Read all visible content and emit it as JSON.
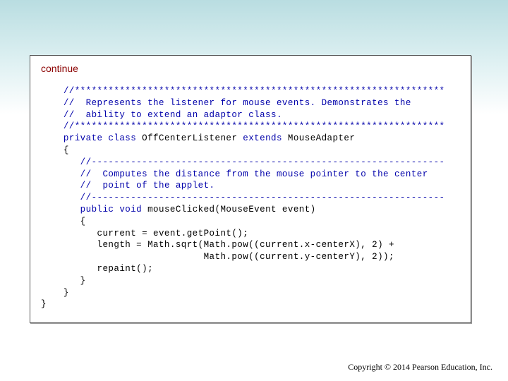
{
  "slide": {
    "heading": "continue",
    "copyright": "Copyright © 2014 Pearson Education, Inc."
  },
  "code_lines": [
    {
      "indent": "    ",
      "segments": [
        {
          "t": "//******************************************************************",
          "c": "cm"
        }
      ]
    },
    {
      "indent": "    ",
      "segments": [
        {
          "t": "//  Represents the listener for mouse events. Demonstrates the",
          "c": "cm"
        }
      ]
    },
    {
      "indent": "    ",
      "segments": [
        {
          "t": "//  ability to extend an adaptor class.",
          "c": "cm"
        }
      ]
    },
    {
      "indent": "    ",
      "segments": [
        {
          "t": "//******************************************************************",
          "c": "cm"
        }
      ]
    },
    {
      "indent": "    ",
      "segments": [
        {
          "t": "private class ",
          "c": "kw"
        },
        {
          "t": "OffCenterListener ",
          "c": ""
        },
        {
          "t": "extends ",
          "c": "kw"
        },
        {
          "t": "MouseAdapter",
          "c": ""
        }
      ]
    },
    {
      "indent": "    ",
      "segments": [
        {
          "t": "{",
          "c": ""
        }
      ]
    },
    {
      "indent": "       ",
      "segments": [
        {
          "t": "//---------------------------------------------------------------",
          "c": "cm"
        }
      ]
    },
    {
      "indent": "       ",
      "segments": [
        {
          "t": "//  Computes the distance from the mouse pointer to the center",
          "c": "cm"
        }
      ]
    },
    {
      "indent": "       ",
      "segments": [
        {
          "t": "//  point of the applet.",
          "c": "cm"
        }
      ]
    },
    {
      "indent": "       ",
      "segments": [
        {
          "t": "//---------------------------------------------------------------",
          "c": "cm"
        }
      ]
    },
    {
      "indent": "       ",
      "segments": [
        {
          "t": "public void ",
          "c": "kw"
        },
        {
          "t": "mouseClicked(MouseEvent event)",
          "c": ""
        }
      ]
    },
    {
      "indent": "       ",
      "segments": [
        {
          "t": "{",
          "c": ""
        }
      ]
    },
    {
      "indent": "          ",
      "segments": [
        {
          "t": "current = event.getPoint();",
          "c": ""
        }
      ]
    },
    {
      "indent": "          ",
      "segments": [
        {
          "t": "length = Math.sqrt(Math.pow((current.x-centerX), 2) +",
          "c": ""
        }
      ]
    },
    {
      "indent": "                             ",
      "segments": [
        {
          "t": "Math.pow((current.y-centerY), 2));",
          "c": ""
        }
      ]
    },
    {
      "indent": "          ",
      "segments": [
        {
          "t": "repaint();",
          "c": ""
        }
      ]
    },
    {
      "indent": "       ",
      "segments": [
        {
          "t": "}",
          "c": ""
        }
      ]
    },
    {
      "indent": "    ",
      "segments": [
        {
          "t": "}",
          "c": ""
        }
      ]
    },
    {
      "indent": "",
      "segments": [
        {
          "t": "}",
          "c": ""
        }
      ]
    }
  ]
}
